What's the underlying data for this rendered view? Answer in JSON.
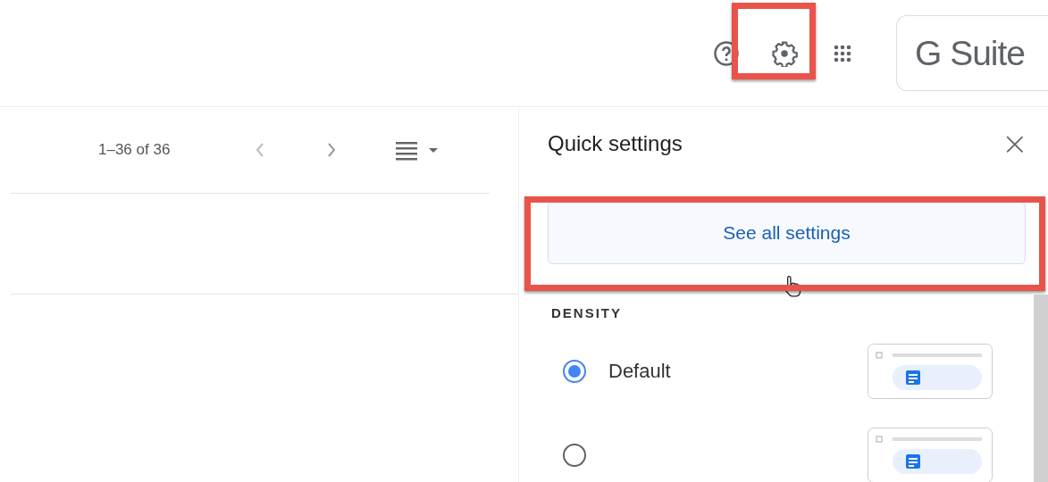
{
  "top_bar": {
    "product": "G Suite"
  },
  "toolbar": {
    "range": "1–36 of 36"
  },
  "quick_settings": {
    "title": "Quick settings",
    "close": "×",
    "button": "See all settings",
    "section": "DENSITY",
    "options": [
      {
        "label": "Default",
        "selected": true
      },
      {
        "selected": false
      }
    ]
  }
}
